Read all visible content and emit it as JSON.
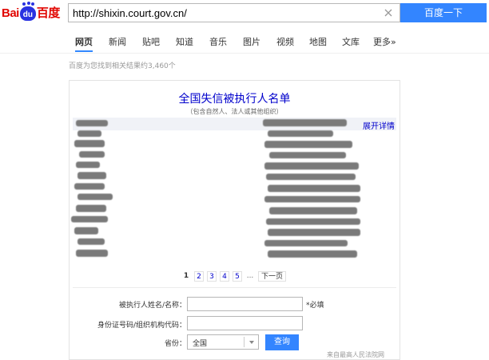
{
  "header": {
    "logo": {
      "part1": "Bai",
      "part2": "du",
      "part3": "百度"
    },
    "search_value": "http://shixin.court.gov.cn/",
    "search_button": "百度一下"
  },
  "tabs": [
    {
      "label": "网页",
      "active": true
    },
    {
      "label": "新闻"
    },
    {
      "label": "贴吧"
    },
    {
      "label": "知道"
    },
    {
      "label": "音乐"
    },
    {
      "label": "图片"
    },
    {
      "label": "视频"
    },
    {
      "label": "地图"
    },
    {
      "label": "文库"
    },
    {
      "label": "更多»"
    }
  ],
  "result_count": "百度为您找到相关结果约3,460个",
  "card": {
    "title": "全国失信被执行人名单",
    "subtitle": "（包含自然人、法人或其他组织）",
    "expand_link": "展开详情",
    "pagination": {
      "pages": [
        "1",
        "2",
        "3",
        "4",
        "5"
      ],
      "current": "1",
      "ellipsis": "...",
      "next": "下一页"
    },
    "form": {
      "name_label": "被执行人姓名/名称：",
      "required_label": "*必填",
      "id_label": "身份证号码/组织机构代码：",
      "province_label": "省份：",
      "province_value": "全国",
      "query_button": "查询"
    },
    "source": "来自最高人民法院网"
  },
  "colors": {
    "accent": "#3385ff",
    "link": "#0000cc",
    "baidu_red": "#e10601",
    "baidu_blue": "#2932e1"
  }
}
